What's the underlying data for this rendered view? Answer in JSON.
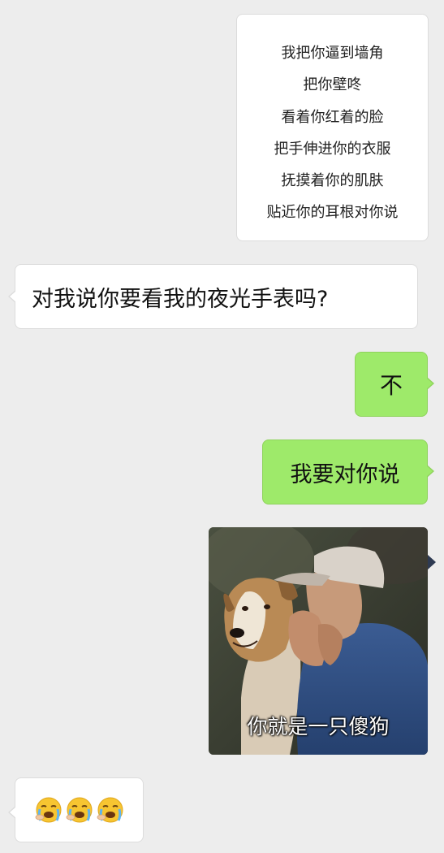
{
  "chat": {
    "messages": [
      {
        "side": "right",
        "type": "text",
        "lines": [
          "我把你逼到墙角",
          "把你壁咚",
          "看着你红着的脸",
          "把手伸进你的衣服",
          "抚摸着你的肌肤",
          "贴近你的耳根对你说"
        ]
      },
      {
        "side": "left",
        "type": "text",
        "text": "对我说你要看我的夜光手表吗?"
      },
      {
        "side": "right",
        "type": "text",
        "text": "不"
      },
      {
        "side": "right",
        "type": "text",
        "text": "我要对你说"
      },
      {
        "side": "right",
        "type": "image",
        "caption": "你就是一只傻狗",
        "image_desc": "man-whispering-to-dog-meme"
      },
      {
        "side": "left",
        "type": "emoji",
        "emoji": [
          "😭",
          "😭",
          "😭"
        ],
        "emoji_icon": "crying-face-icon"
      }
    ]
  },
  "colors": {
    "background": "#ededed",
    "sent_bubble": "#9eea6a",
    "received_bubble": "#ffffff"
  }
}
